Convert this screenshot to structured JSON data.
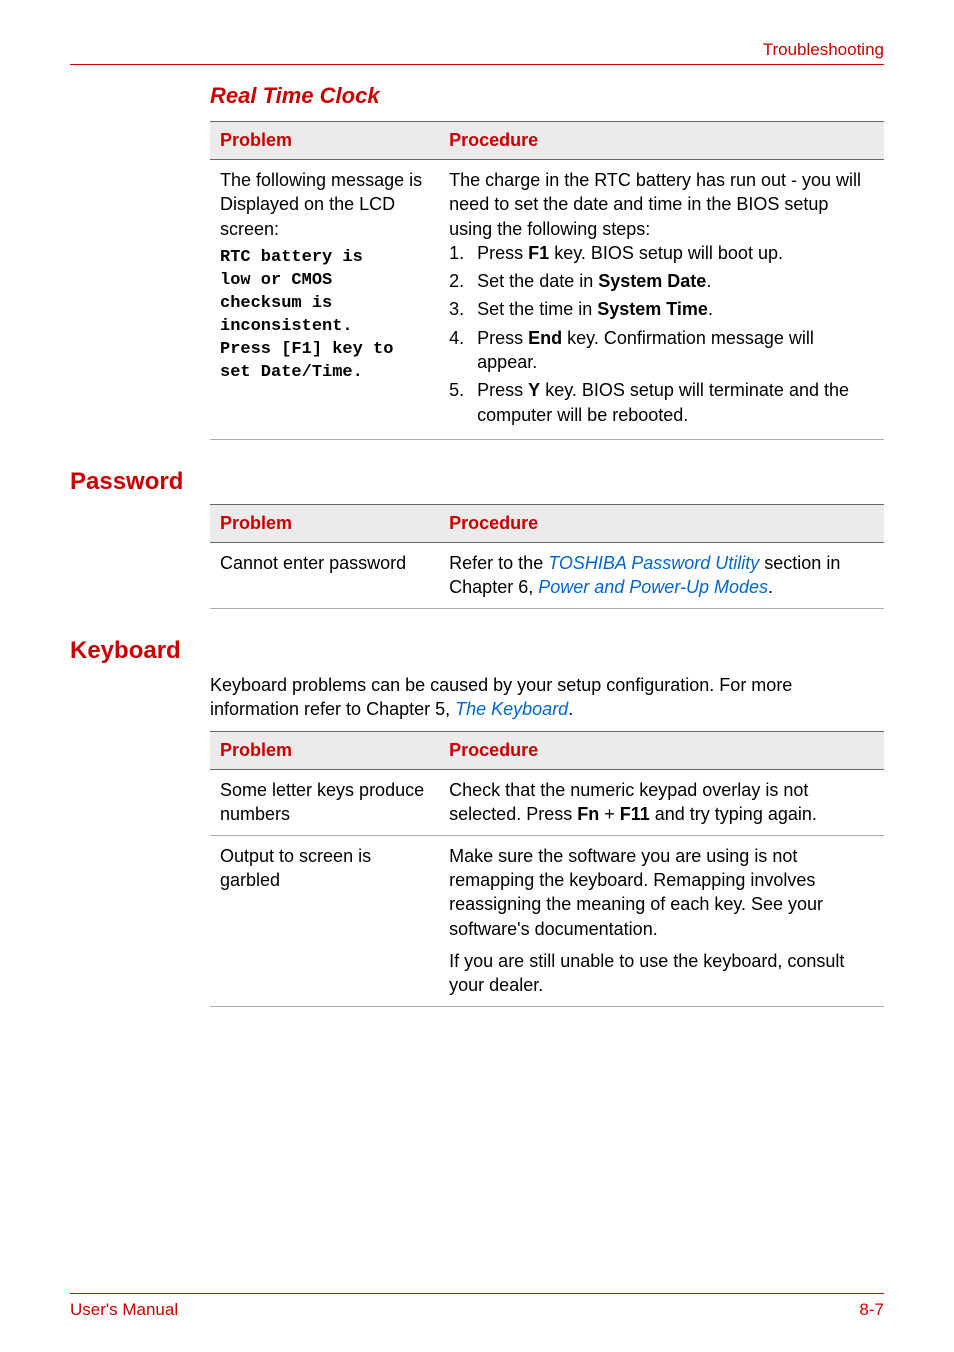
{
  "header": {
    "section": "Troubleshooting"
  },
  "rtc": {
    "heading": "Real Time Clock",
    "col1": "Problem",
    "col2": "Procedure",
    "problem_intro": "The following message is Displayed on the LCD screen:",
    "problem_msg_l1": "RTC battery is",
    "problem_msg_l2": "low or CMOS",
    "problem_msg_l3": "checksum is",
    "problem_msg_l4": "inconsistent.",
    "problem_msg_l5": "Press [F1] key to",
    "problem_msg_l6": "set Date/Time.",
    "proc_intro": "The charge in the RTC battery has run out - you will need to set the date and time in the BIOS setup using the following steps:",
    "step1_a": "Press ",
    "step1_b": "F1",
    "step1_c": " key. BIOS setup will boot up.",
    "step2_a": "Set the date in ",
    "step2_b": "System Date",
    "step2_c": ".",
    "step3_a": "Set the time in ",
    "step3_b": "System Time",
    "step3_c": ".",
    "step4_a": "Press ",
    "step4_b": "End",
    "step4_c": " key. Confirmation message will appear.",
    "step5_a": "Press ",
    "step5_b": "Y",
    "step5_c": " key. BIOS setup will terminate and the computer will be rebooted."
  },
  "password": {
    "heading": "Password",
    "col1": "Problem",
    "col2": "Procedure",
    "problem": "Cannot enter password",
    "proc_a": "Refer to the ",
    "proc_link1": "TOSHIBA Password Utility",
    "proc_b": " section in Chapter 6, ",
    "proc_link2": "Power and Power-Up Modes",
    "proc_c": "."
  },
  "keyboard": {
    "heading": "Keyboard",
    "intro_a": "Keyboard problems can be caused by your setup configuration. For more information refer to Chapter 5, ",
    "intro_link": "The Keyboard",
    "intro_b": ".",
    "col1": "Problem",
    "col2": "Procedure",
    "r1_problem": "Some letter keys produce numbers",
    "r1_proc_a": "Check that the numeric keypad overlay is not selected. Press ",
    "r1_proc_b": "Fn",
    "r1_proc_c": " + ",
    "r1_proc_d": "F11",
    "r1_proc_e": " and try typing again.",
    "r2_problem": "Output to screen is garbled",
    "r2_proc1": "Make sure the software you are using is not remapping the keyboard. Remapping involves reassigning the meaning of each key. See your software's documentation.",
    "r2_proc2": "If you are still unable to use the keyboard, consult your dealer."
  },
  "footer": {
    "left": "User's Manual",
    "right": "8-7"
  }
}
